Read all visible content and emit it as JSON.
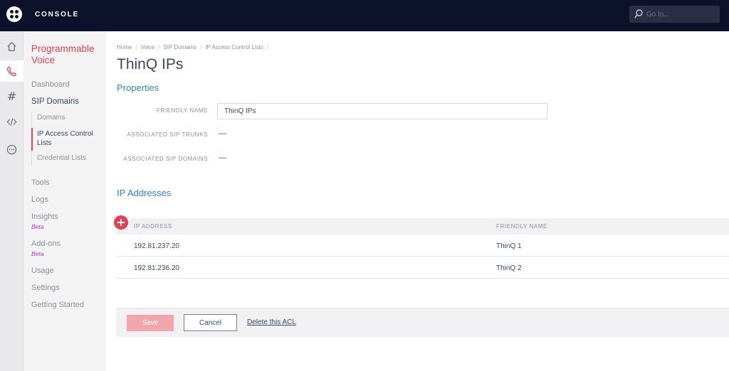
{
  "header": {
    "app_title": "CONSOLE",
    "search_placeholder": "Go to..."
  },
  "rail": {
    "icons": [
      "home-icon",
      "phone-icon",
      "hash-icon",
      "code-icon",
      "more-icon"
    ],
    "hash_glyph": "#"
  },
  "sidebar": {
    "product_title": "Programmable Voice",
    "items": {
      "dashboard": "Dashboard",
      "sip_domains": "SIP Domains",
      "domains": "Domains",
      "ip_acl": "IP Access Control Lists",
      "credential_lists": "Credential Lists",
      "tools": "Tools",
      "logs": "Logs",
      "insights": "Insights",
      "insights_badge": "Beta",
      "addons": "Add-ons",
      "addons_badge": "Beta",
      "usage": "Usage",
      "settings": "Settings",
      "getting_started": "Getting Started"
    }
  },
  "breadcrumb": [
    "Home",
    "Voice",
    "SIP Domains",
    "IP Access Control Lists"
  ],
  "page_title": "ThinQ IPs",
  "properties": {
    "section_title": "Properties",
    "friendly_name_label": "FRIENDLY NAME",
    "friendly_name_value": "ThinQ IPs",
    "trunks_label": "ASSOCIATED SIP TRUNKS",
    "trunks_value": "—",
    "domains_label": "ASSOCIATED SIP DOMAINS",
    "domains_value": "—"
  },
  "ip_addresses": {
    "section_title": "IP Addresses",
    "columns": [
      "IP ADDRESS",
      "FRIENDLY NAME"
    ],
    "rows": [
      {
        "ip": "192.81.237.20",
        "name": "ThinQ 1"
      },
      {
        "ip": "192.81.236.20",
        "name": "ThinQ 2"
      }
    ]
  },
  "actions": {
    "save": "Save",
    "cancel": "Cancel",
    "delete": "Delete this ACL"
  },
  "colors": {
    "topbar": "#0d122b",
    "accent": "#e44150",
    "link": "#2f83d3",
    "beta": "#a93ad1"
  }
}
